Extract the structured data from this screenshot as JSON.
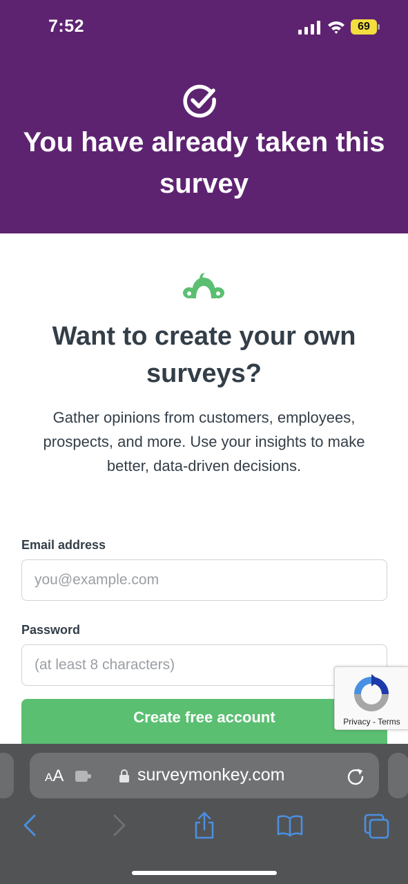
{
  "status_bar": {
    "time": "7:52",
    "battery": "69"
  },
  "hero": {
    "title": "You have already taken this survey",
    "icon": "check-circle-icon"
  },
  "promo": {
    "logo": "surveymonkey-logo",
    "title": "Want to create your own surveys?",
    "description": "Gather opinions from customers, employees, prospects, and more. Use your insights to make better, data-driven decisions."
  },
  "form": {
    "email_label": "Email address",
    "email_placeholder": "you@example.com",
    "password_label": "Password",
    "password_placeholder": "(at least 8 characters)",
    "submit_label": "Create free account"
  },
  "recaptcha": {
    "privacy": "Privacy",
    "separator": " - ",
    "terms": "Terms"
  },
  "browser": {
    "text_size_label_small": "A",
    "text_size_label_large": "A",
    "url": "surveymonkey.com"
  },
  "colors": {
    "hero_background": "#5d2370",
    "accent_green": "#5bbf72",
    "text_dark": "#333e48"
  }
}
